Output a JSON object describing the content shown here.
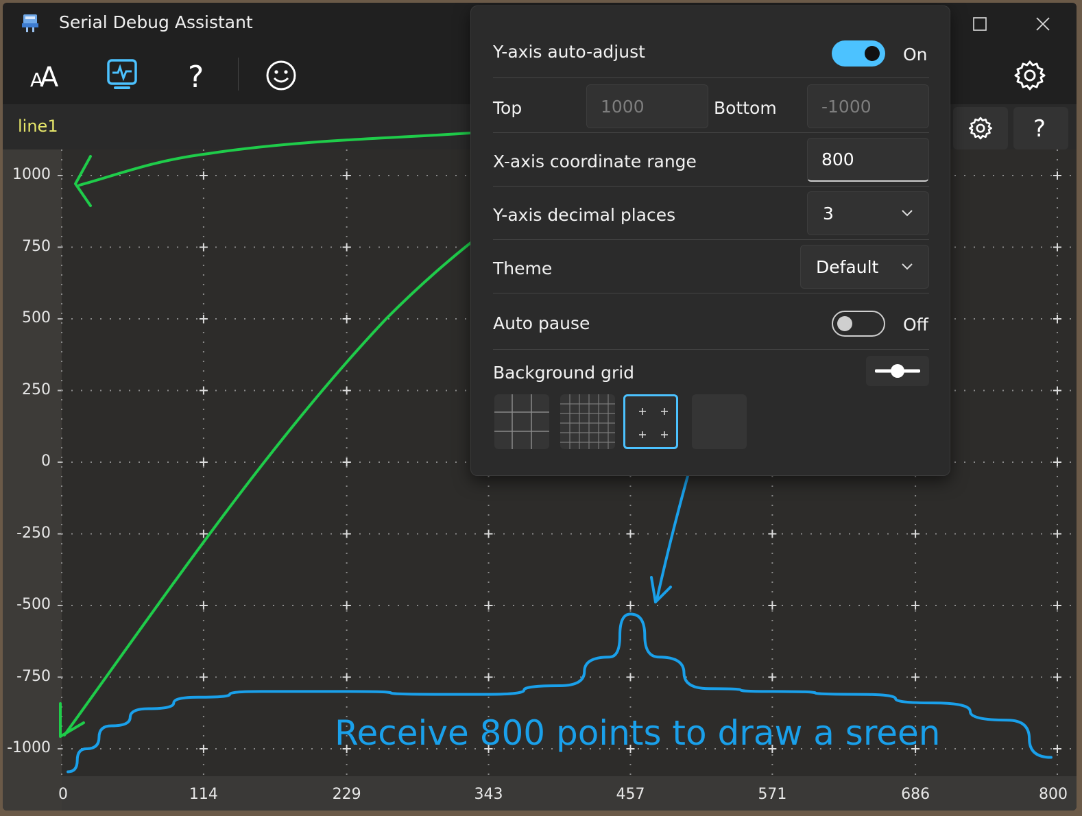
{
  "window": {
    "title": "Serial Debug Assistant"
  },
  "toolbar": {
    "font_icon": "font-size-icon",
    "plot_icon": "waveform-monitor-icon",
    "help_icon": "question-icon",
    "emoji_icon": "smiley-icon",
    "settings_icon": "gear-icon"
  },
  "plot_strip": {
    "series_label": "line1"
  },
  "settings_panel": {
    "y_auto_adjust": {
      "label": "Y-axis auto-adjust",
      "state_text": "On",
      "enabled": true
    },
    "top": {
      "label": "Top",
      "value": "1000"
    },
    "bottom": {
      "label": "Bottom",
      "value": "-1000"
    },
    "x_range": {
      "label": "X-axis coordinate range",
      "value": "800"
    },
    "y_decimals": {
      "label": "Y-axis decimal places",
      "value": "3"
    },
    "theme": {
      "label": "Theme",
      "value": "Default"
    },
    "auto_pause": {
      "label": "Auto pause",
      "state_text": "Off",
      "enabled": false
    },
    "background_grid": {
      "label": "Background grid",
      "options": [
        "lines",
        "fine-lines",
        "crosses",
        "none"
      ],
      "selected": "crosses"
    }
  },
  "annotation": {
    "text": "Receive 800 points to draw a sreen",
    "color": "#1aa0ea"
  },
  "colors": {
    "accent": "#4cc2ff",
    "series_label": "#e7e76a",
    "green_annotation": "#1fcc4a",
    "blue_annotation": "#1aa0ea"
  },
  "chart_data": {
    "type": "line",
    "x_ticks": [
      "0",
      "114",
      "229",
      "343",
      "457",
      "571",
      "686",
      "800"
    ],
    "y_ticks": [
      "1000",
      "750",
      "500",
      "250",
      "0",
      "-250",
      "-500",
      "-750",
      "-1000"
    ],
    "xlim": [
      0,
      800
    ],
    "ylim": [
      -1050,
      1050
    ],
    "grid": "crosses",
    "series": [
      {
        "color": "#1aa0ea",
        "x": [
          5,
          20,
          40,
          70,
          110,
          160,
          229,
          300,
          343,
          400,
          440,
          457,
          480,
          520,
          571,
          640,
          700,
          760,
          795
        ],
        "y": [
          -1080,
          -1000,
          -920,
          -860,
          -820,
          -800,
          -800,
          -810,
          -810,
          -780,
          -680,
          -530,
          -680,
          -790,
          -800,
          -810,
          -840,
          -900,
          -1030
        ]
      }
    ]
  }
}
